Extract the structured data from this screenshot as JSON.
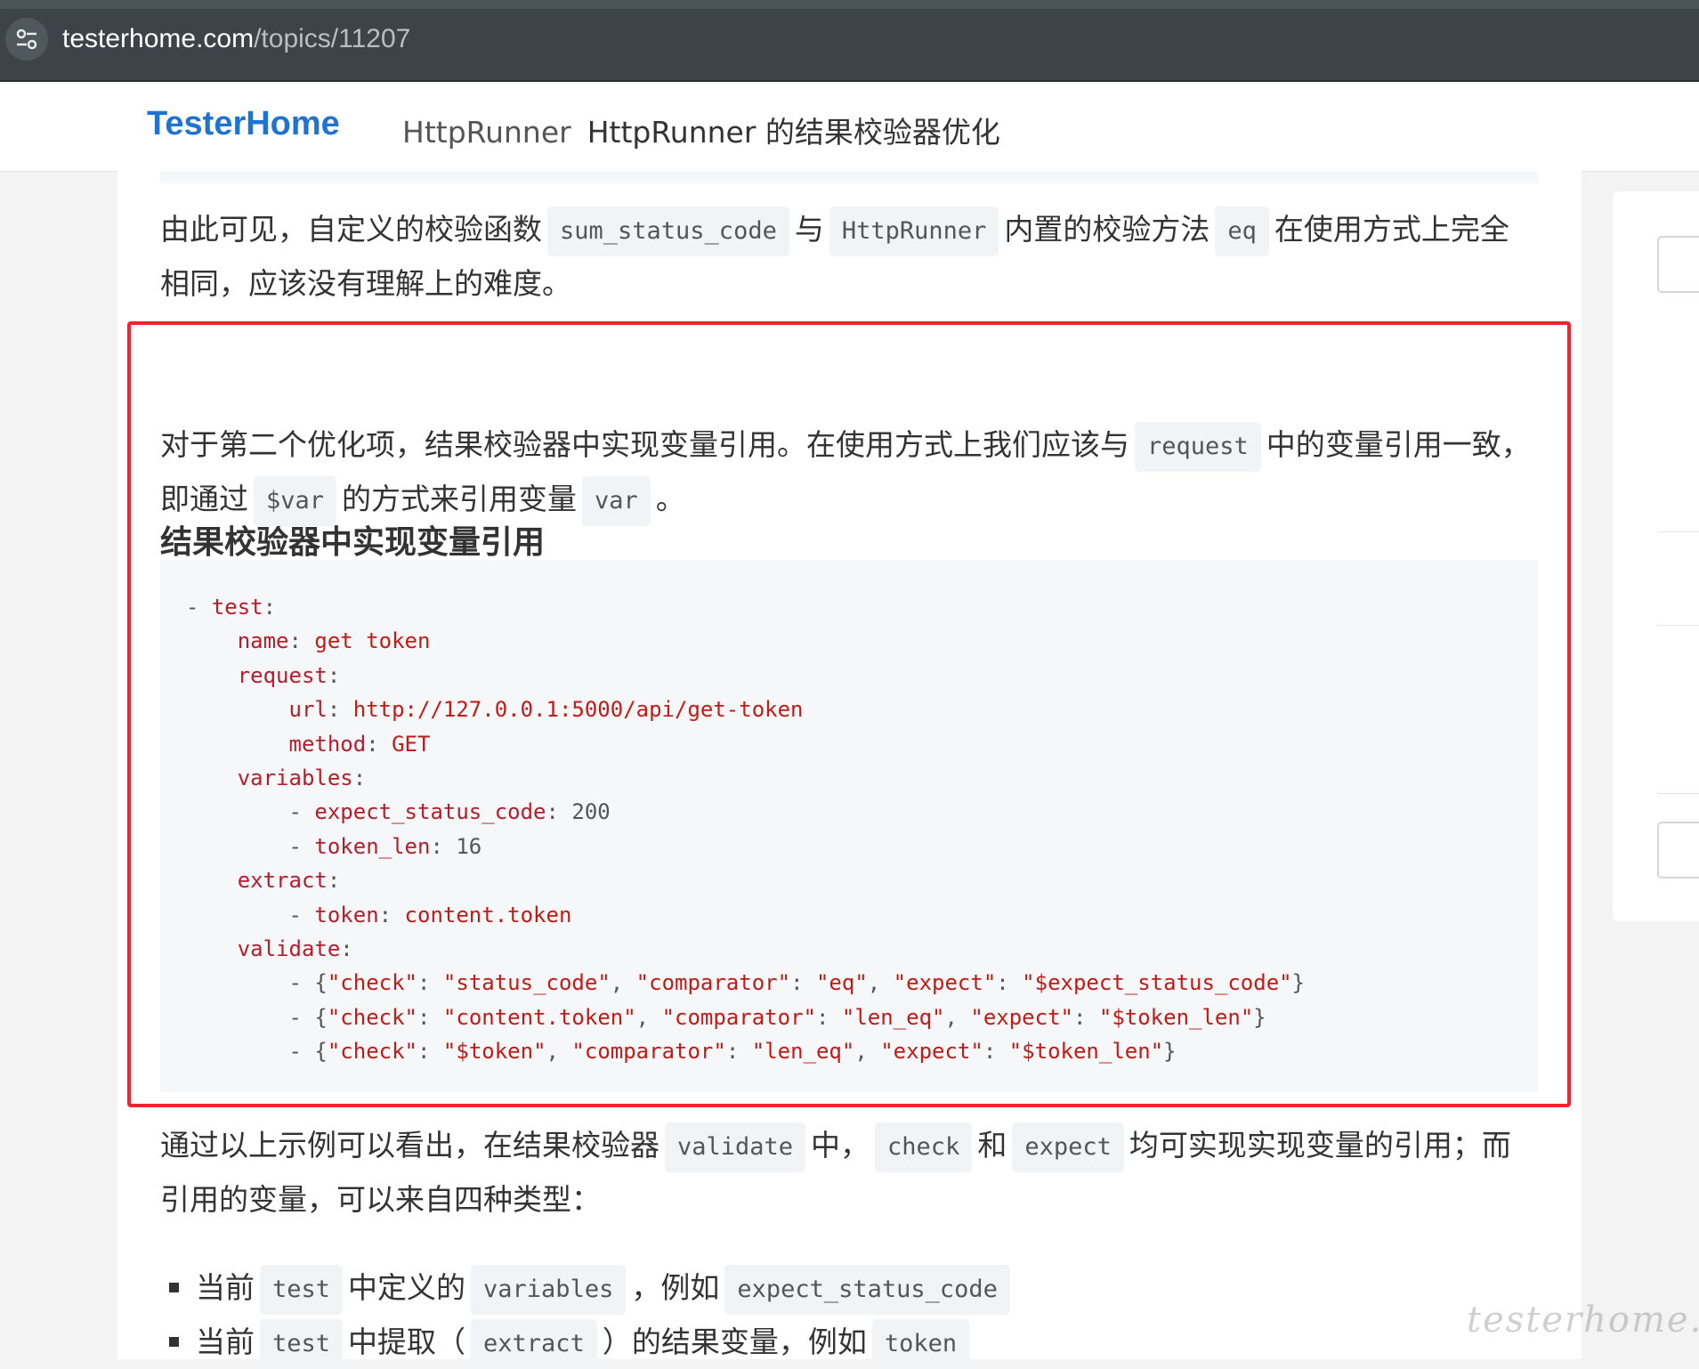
{
  "browser": {
    "url_host": "testerhome.com",
    "url_path": "/topics/11207",
    "site_info_icon": "tune-icon"
  },
  "header": {
    "brand": "TesterHome",
    "node": "HttpRunner",
    "title": "HttpRunner 的结果校验器优化"
  },
  "article": {
    "para1": {
      "t1": "由此可见，自定义的校验函数",
      "c1": "sum_status_code",
      "t2": "与",
      "c2": "HttpRunner",
      "t3": "内置的校验方法",
      "c3": "eq",
      "t4": "在使用方式上完全相同，应该没有理解上的难度。"
    },
    "section_heading": "结果校验器中实现变量引用",
    "para2": {
      "t1": "对于第二个优化项，结果校验器中实现变量引用。在使用方式上我们应该与",
      "c1": "request",
      "t2": "中的变量引用一致，即通过",
      "c2": "$var",
      "t3": "的方式来引用变量",
      "c3": "var",
      "t4": "。"
    },
    "code_lines": [
      "- test:",
      "    name: get token",
      "    request:",
      "        url: http://127.0.0.1:5000/api/get-token",
      "        method: GET",
      "    variables:",
      "        - expect_status_code: 200",
      "        - token_len: 16",
      "    extract:",
      "        - token: content.token",
      "    validate:",
      "        - {\"check\": \"status_code\", \"comparator\": \"eq\", \"expect\": \"$expect_status_code\"}",
      "        - {\"check\": \"content.token\", \"comparator\": \"len_eq\", \"expect\": \"$token_len\"}",
      "        - {\"check\": \"$token\", \"comparator\": \"len_eq\", \"expect\": \"$token_len\"}"
    ],
    "para3": {
      "t1": "通过以上示例可以看出，在结果校验器",
      "c1": "validate",
      "t2": "中，",
      "c2": "check",
      "t3": "和",
      "c3": "expect",
      "t4": "均可实现实现变量的引用；而引用的变量，可以来自四种类型："
    },
    "list": [
      {
        "t1": "当前",
        "c1": "test",
        "t2": "中定义的",
        "c2": "variables",
        "t3": "，例如",
        "c3": "expect_status_code",
        "t4": ""
      },
      {
        "t1": "当前",
        "c1": "test",
        "t2": "中提取（",
        "c2": "extract",
        "t3": "）的结果变量，例如",
        "c3": "token",
        "t4": ""
      }
    ]
  },
  "watermark": "testerhome.com",
  "colors": {
    "brand": "#1f74d1",
    "highlight_border": "#f5222d",
    "code_key": "#b71c2b",
    "code_bg": "#f6f7f9"
  }
}
